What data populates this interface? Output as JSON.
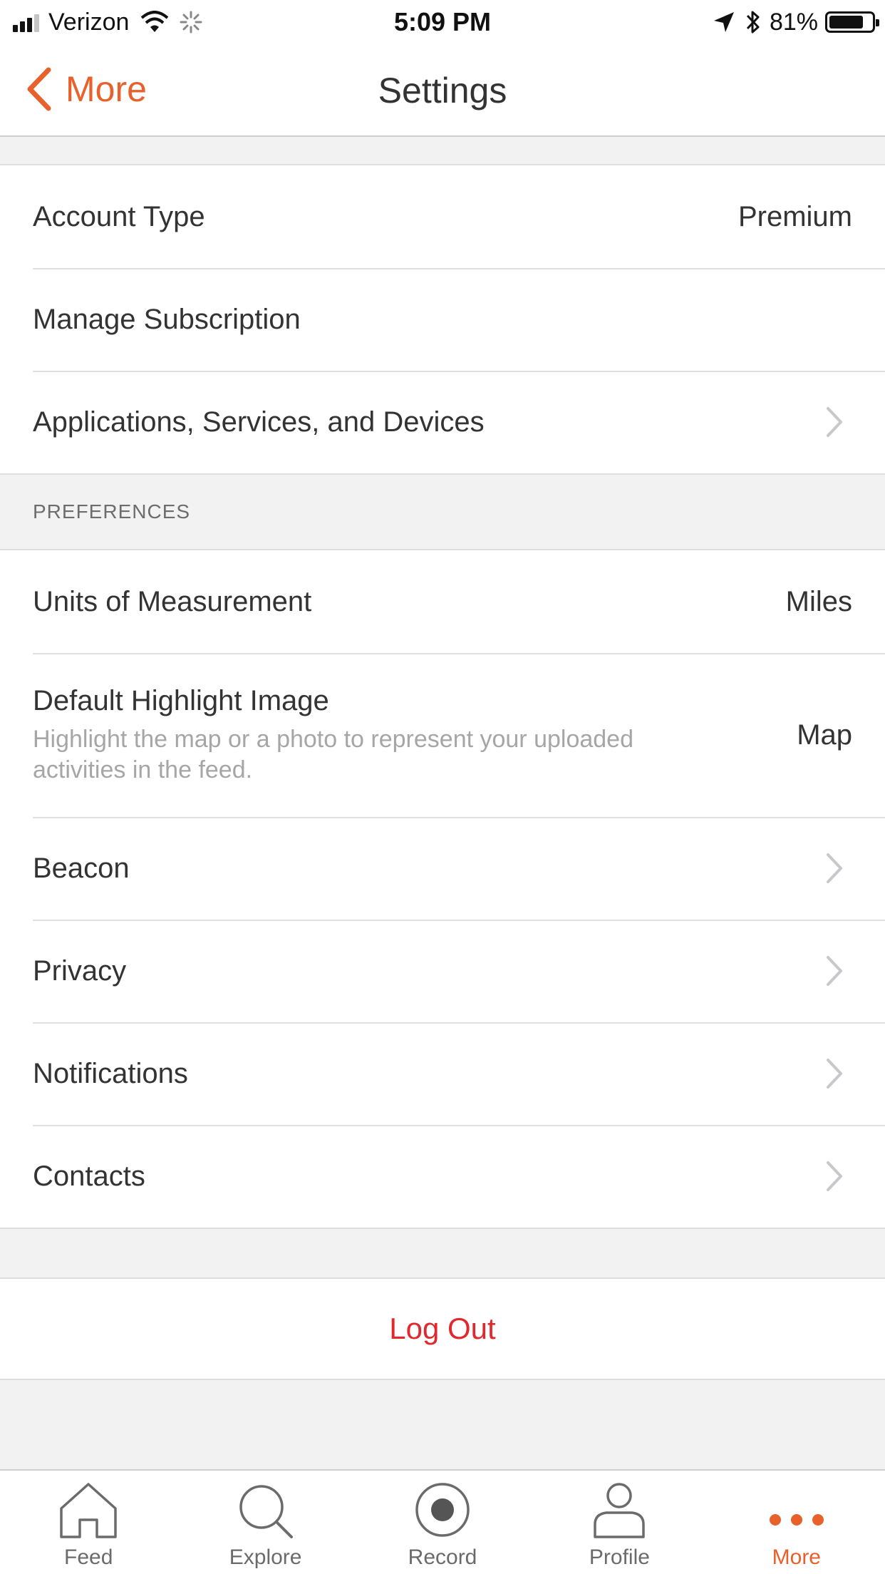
{
  "status_bar": {
    "carrier": "Verizon",
    "time": "5:09 PM",
    "battery_text": "81%",
    "battery_level": 0.81
  },
  "nav": {
    "back_label": "More",
    "title": "Settings"
  },
  "account_group": [
    {
      "label": "Account Type",
      "value": "Premium"
    },
    {
      "label": "Manage Subscription",
      "value": ""
    },
    {
      "label": "Applications, Services, and Devices",
      "value": ""
    }
  ],
  "preferences": {
    "header": "PREFERENCES",
    "units": {
      "label": "Units of Measurement",
      "value": "Miles"
    },
    "highlight": {
      "label": "Default Highlight Image",
      "subtitle": "Highlight the map or a photo to represent your uploaded activities in the feed.",
      "value": "Map"
    },
    "items": [
      {
        "label": "Beacon"
      },
      {
        "label": "Privacy"
      },
      {
        "label": "Notifications"
      },
      {
        "label": "Contacts"
      }
    ]
  },
  "logout_label": "Log Out",
  "tabs": [
    {
      "label": "Feed",
      "icon": "home-icon"
    },
    {
      "label": "Explore",
      "icon": "search-icon"
    },
    {
      "label": "Record",
      "icon": "record-icon"
    },
    {
      "label": "Profile",
      "icon": "person-icon"
    },
    {
      "label": "More",
      "icon": "more-dots-icon"
    }
  ],
  "colors": {
    "accent": "#e8612c",
    "logout": "#e0282d",
    "chevron": "#c7c7cc"
  }
}
